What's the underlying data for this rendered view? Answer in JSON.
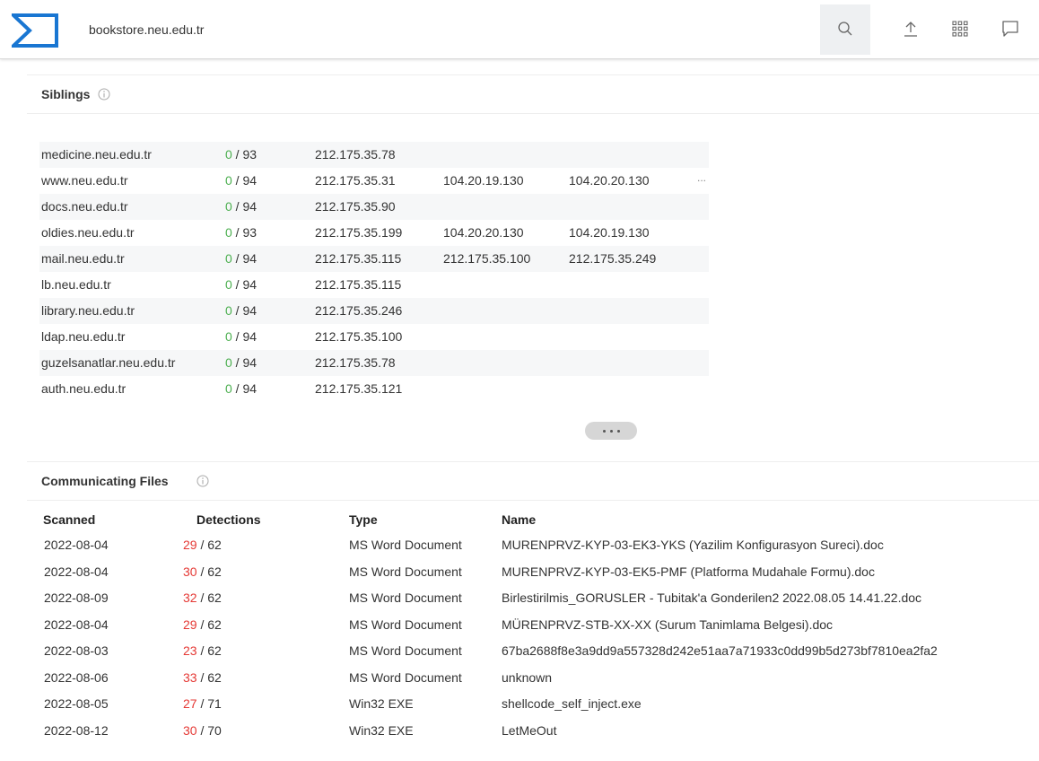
{
  "topbar": {
    "url": "bookstore.neu.edu.tr",
    "icons": [
      "search-icon",
      "upload-icon",
      "apps-icon",
      "chat-icon"
    ]
  },
  "siblings": {
    "title": "Siblings",
    "rows": [
      {
        "domain": "medicine.neu.edu.tr",
        "det": "0",
        "total": "93",
        "ips": [
          "212.175.35.78"
        ],
        "more": ""
      },
      {
        "domain": "www.neu.edu.tr",
        "det": "0",
        "total": "94",
        "ips": [
          "212.175.35.31",
          "104.20.19.130",
          "104.20.20.130"
        ],
        "more": "..."
      },
      {
        "domain": "docs.neu.edu.tr",
        "det": "0",
        "total": "94",
        "ips": [
          "212.175.35.90"
        ],
        "more": ""
      },
      {
        "domain": "oldies.neu.edu.tr",
        "det": "0",
        "total": "93",
        "ips": [
          "212.175.35.199",
          "104.20.20.130",
          "104.20.19.130"
        ],
        "more": ""
      },
      {
        "domain": "mail.neu.edu.tr",
        "det": "0",
        "total": "94",
        "ips": [
          "212.175.35.115",
          "212.175.35.100",
          "212.175.35.249"
        ],
        "more": ""
      },
      {
        "domain": "lb.neu.edu.tr",
        "det": "0",
        "total": "94",
        "ips": [
          "212.175.35.115"
        ],
        "more": ""
      },
      {
        "domain": "library.neu.edu.tr",
        "det": "0",
        "total": "94",
        "ips": [
          "212.175.35.246"
        ],
        "more": ""
      },
      {
        "domain": "ldap.neu.edu.tr",
        "det": "0",
        "total": "94",
        "ips": [
          "212.175.35.100"
        ],
        "more": ""
      },
      {
        "domain": "guzelsanatlar.neu.edu.tr",
        "det": "0",
        "total": "94",
        "ips": [
          "212.175.35.78"
        ],
        "more": ""
      },
      {
        "domain": "auth.neu.edu.tr",
        "det": "0",
        "total": "94",
        "ips": [
          "212.175.35.121"
        ],
        "more": ""
      }
    ]
  },
  "files": {
    "title": "Communicating Files",
    "columns": {
      "scanned": "Scanned",
      "detections": "Detections",
      "type": "Type",
      "name": "Name"
    },
    "rows": [
      {
        "scanned": "2022-08-04",
        "det": "29",
        "total": "62",
        "type": "MS Word Document",
        "name": "MURENPRVZ-KYP-03-EK3-YKS (Yazilim Konfigurasyon Sureci).doc"
      },
      {
        "scanned": "2022-08-04",
        "det": "30",
        "total": "62",
        "type": "MS Word Document",
        "name": "MURENPRVZ-KYP-03-EK5-PMF (Platforma Mudahale Formu).doc"
      },
      {
        "scanned": "2022-08-09",
        "det": "32",
        "total": "62",
        "type": "MS Word Document",
        "name": "Birlestirilmis_GORUSLER - Tubitak'a Gonderilen2 2022.08.05 14.41.22.doc"
      },
      {
        "scanned": "2022-08-04",
        "det": "29",
        "total": "62",
        "type": "MS Word Document",
        "name": "MÜRENPRVZ-STB-XX-XX (Surum Tanimlama Belgesi).doc"
      },
      {
        "scanned": "2022-08-03",
        "det": "23",
        "total": "62",
        "type": "MS Word Document",
        "name": "67ba2688f8e3a9dd9a557328d242e51aa7a71933c0dd99b5d273bf7810ea2fa2"
      },
      {
        "scanned": "2022-08-06",
        "det": "33",
        "total": "62",
        "type": "MS Word Document",
        "name": "unknown"
      },
      {
        "scanned": "2022-08-05",
        "det": "27",
        "total": "71",
        "type": "Win32 EXE",
        "name": "shellcode_self_inject.exe"
      },
      {
        "scanned": "2022-08-12",
        "det": "30",
        "total": "70",
        "type": "Win32 EXE",
        "name": "LetMeOut"
      }
    ]
  },
  "colors": {
    "brand": "#1976d2",
    "clean": "#4caf50",
    "malicious": "#e53935"
  }
}
